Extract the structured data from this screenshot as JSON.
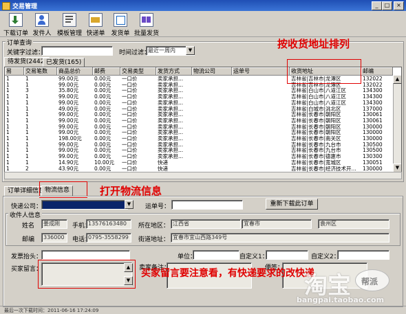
{
  "window": {
    "title": "交易管理",
    "controls": [
      "_",
      "□",
      "×"
    ]
  },
  "toolbar": [
    {
      "label": "下载订单",
      "icon": "download-icon"
    },
    {
      "label": "发件人",
      "icon": "sender-icon"
    },
    {
      "label": "模板管理",
      "icon": "template-icon"
    },
    {
      "label": "快递单",
      "icon": "express-icon"
    },
    {
      "label": "发货单",
      "icon": "shipping-icon"
    },
    {
      "label": "批量发货",
      "icon": "batch-ship-icon"
    }
  ],
  "query": {
    "legend": "订单查询",
    "keyword_label": "关键字过滤：",
    "keyword_value": "",
    "time_label": "时间过滤：",
    "time_value": "最近一周内"
  },
  "order_tabs": [
    {
      "label": "待发货(2442)"
    },
    {
      "label": "已发货(165)"
    }
  ],
  "table": {
    "columns": [
      "易",
      "交易笔数",
      "商品总价",
      "邮费",
      "交易类型",
      "发货方式",
      "物流公司",
      "运单号",
      "收货地址",
      "邮编"
    ],
    "rows": [
      [
        "1",
        "1",
        "99.00元",
        "0.00元",
        "一口价",
        "卖家承担...",
        "",
        "",
        "吉林省|吉林市|龙潭区",
        "132022"
      ],
      [
        "1",
        "1",
        "99.00元",
        "0.00元",
        "一口价",
        "卖家承担...",
        "",
        "",
        "吉林省|吉林市|龙潭区",
        "132022"
      ],
      [
        "1",
        "3",
        "35.80元",
        "0.00元",
        "一口价",
        "卖家承担...",
        "",
        "",
        "吉林省|白山市|八道江区",
        "134300"
      ],
      [
        "1",
        "1",
        "99.00元",
        "0.00元",
        "一口价",
        "卖家承担...",
        "",
        "",
        "吉林省|白山市|八道江区",
        "134300"
      ],
      [
        "1",
        "1",
        "99.00元",
        "0.00元",
        "一口价",
        "卖家承担...",
        "",
        "",
        "吉林省|白山市|八道江区",
        "134300"
      ],
      [
        "1",
        "1",
        "49.00元",
        "0.00元",
        "一口价",
        "卖家承担...",
        "",
        "",
        "吉林省|白城市|洮北区",
        "137000"
      ],
      [
        "1",
        "1",
        "99.00元",
        "0.00元",
        "一口价",
        "卖家承担...",
        "",
        "",
        "吉林省|长春市|朝阳区",
        "130061"
      ],
      [
        "1",
        "1",
        "99.00元",
        "0.00元",
        "一口价",
        "卖家承担...",
        "",
        "",
        "吉林省|长春市|朝阳区",
        "130061"
      ],
      [
        "1",
        "1",
        "99.00元",
        "0.00元",
        "一口价",
        "卖家承担...",
        "",
        "",
        "吉林省|长春市|朝阳区",
        "130000"
      ],
      [
        "1",
        "1",
        "99.00元",
        "0.00元",
        "一口价",
        "卖家承担...",
        "",
        "",
        "吉林省|长春市|朝阳区",
        "130000"
      ],
      [
        "1",
        "1",
        "198.00元",
        "0.00元",
        "一口价",
        "卖家承担...",
        "",
        "",
        "吉林省|长春市|南关区",
        "130000"
      ],
      [
        "1",
        "1",
        "99.00元",
        "0.00元",
        "一口价",
        "卖家承担...",
        "",
        "",
        "吉林省|长春市|九台市",
        "130500"
      ],
      [
        "1",
        "1",
        "99.00元",
        "0.00元",
        "一口价",
        "卖家承担...",
        "",
        "",
        "吉林省|长春市|九台市",
        "130500"
      ],
      [
        "1",
        "1",
        "99.00元",
        "0.00元",
        "一口价",
        "卖家承担...",
        "",
        "",
        "吉林省|长春市|德惠市",
        "130300"
      ],
      [
        "1",
        "1",
        "14.90元",
        "10.00元",
        "一口价",
        "快递",
        "",
        "",
        "吉林省|长春市|宽城区",
        "130051"
      ],
      [
        "1",
        "2",
        "43.90元",
        "0.00元",
        "一口价",
        "快递",
        "",
        "",
        "吉林省|长春市|经济技术开...",
        "130000"
      ]
    ]
  },
  "detail_tabs": [
    {
      "label": "订单详细信息"
    },
    {
      "label": "物流信息"
    }
  ],
  "logistics": {
    "express_label": "快递公司：",
    "express_value": "",
    "waybill_label": "运单号：",
    "waybill_value": "",
    "redownload_button": "重新下载此订单",
    "receiver_legend": "收件人信息",
    "name_label": "姓名",
    "name_value": "姜成刚",
    "mobile_label": "手机：",
    "mobile_value": "13576163480",
    "region_label": "所在地区：",
    "province_value": "江西省",
    "city_value": "宜春市",
    "district_value": "袁州区",
    "postcode_label": "邮编",
    "postcode_value": "336000",
    "phone_label": "电话：",
    "phone_value": "0795-3558299",
    "address_label": "街道地址：",
    "address_value": "宜春市宜山西路349号",
    "invoice_label": "发票抬头：",
    "unit_label": "单位：",
    "custom1_label": "自定义1：",
    "custom2_label": "自定义2：",
    "buyer_msg_label": "买家留言：",
    "seller_note_label": "卖家备注：",
    "memo_label": "便签："
  },
  "annotations": {
    "sort": "按收货地址排列",
    "open_logistics": "打开物流信息",
    "buyer_msg": "买家留言要注意看，有快递要求的改快递"
  },
  "status_bar": {
    "text": "最后一次下载时间：2011-06-16 17:24:09"
  },
  "watermark": {
    "logo": "淘宝",
    "badge": "帮派",
    "url": "bangpai.taobao.com"
  },
  "colors": {
    "annotation": "#e00000",
    "titlebar": "#2a5fc4"
  }
}
